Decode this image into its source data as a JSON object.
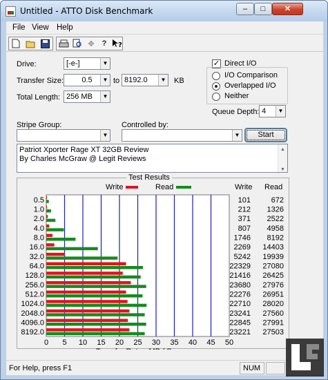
{
  "window": {
    "title": "Untitled - ATTO Disk Benchmark",
    "minimize": "–",
    "maximize": "□",
    "close": "✕"
  },
  "menu": [
    "File",
    "View",
    "Help"
  ],
  "toolbar": {
    "icons": [
      "new-icon",
      "open-icon",
      "save-icon",
      "print-icon",
      "print-preview-icon",
      "move-icon",
      "help-icon",
      "context-help-icon"
    ]
  },
  "form": {
    "drive_label": "Drive:",
    "drive_value": "[-e-]",
    "transfer_size_label": "Transfer Size:",
    "transfer_from": "0.5",
    "to_label": "to",
    "transfer_to": "8192.0",
    "kb_label": "KB",
    "total_length_label": "Total Length:",
    "total_length_value": "256 MB",
    "direct_io_label": "Direct I/O",
    "direct_io_checked": true,
    "io_comparison_label": "I/O Comparison",
    "overlapped_io_label": "Overlapped I/O",
    "neither_label": "Neither",
    "io_mode_selected": "Overlapped I/O",
    "queue_depth_label": "Queue Depth:",
    "queue_depth_value": "4",
    "stripe_group_label": "Stripe Group:",
    "stripe_group_value": "",
    "controlled_by_label": "Controlled by:",
    "controlled_by_value": "",
    "start_button": "Start"
  },
  "notes": [
    "Patriot Xporter Rage XT 32GB Review",
    "By Charles McGraw @ Legit Reviews"
  ],
  "chart_data": {
    "type": "bar",
    "title": "Test Results",
    "xlabel": "Transfer Rate - MB / Sec",
    "xlim": [
      0,
      50
    ],
    "xticks": [
      "0",
      "5",
      "10",
      "15",
      "20",
      "25",
      "30",
      "35",
      "40",
      "45",
      "50"
    ],
    "grid": true,
    "legend": [
      "Write",
      "Read"
    ],
    "colors": {
      "write": "#e0141e",
      "read": "#178a1c",
      "grid": "#1d1db8"
    },
    "categories": [
      "0.5",
      "1.0",
      "2.0",
      "4.0",
      "8.0",
      "16.0",
      "32.0",
      "64.0",
      "128.0",
      "256.0",
      "512.0",
      "1024.0",
      "2048.0",
      "4096.0",
      "8192.0"
    ],
    "series": [
      {
        "name": "Write",
        "values": [
          0.1,
          0.2,
          0.4,
          0.8,
          1.7,
          2.2,
          5.1,
          21.8,
          20.9,
          23.1,
          21.8,
          22.2,
          22.7,
          22.3,
          22.7
        ]
      },
      {
        "name": "Read",
        "values": [
          0.7,
          1.3,
          2.5,
          4.8,
          8.0,
          14.1,
          19.5,
          26.4,
          25.8,
          27.3,
          26.3,
          27.4,
          26.9,
          27.3,
          26.9
        ]
      }
    ],
    "columns": {
      "write_header": "Write",
      "read_header": "Read"
    },
    "write_text": [
      "101",
      "212",
      "371",
      "807",
      "1746",
      "2269",
      "5242",
      "22329",
      "21416",
      "23680",
      "22276",
      "22710",
      "23241",
      "22845",
      "23221"
    ],
    "read_text": [
      "672",
      "1326",
      "2522",
      "4958",
      "8192",
      "14403",
      "19939",
      "27080",
      "26425",
      "27976",
      "26951",
      "28020",
      "27560",
      "27991",
      "27503"
    ]
  },
  "status": {
    "text": "For Help, press F1",
    "num": "NUM"
  }
}
